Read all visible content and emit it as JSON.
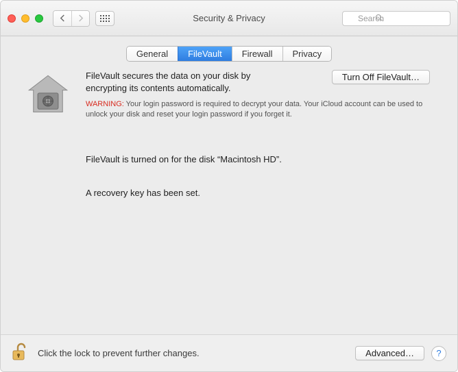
{
  "window": {
    "title": "Security & Privacy"
  },
  "toolbar": {
    "search_placeholder": "Search"
  },
  "tabs": [
    {
      "label": "General"
    },
    {
      "label": "FileVault",
      "active": true
    },
    {
      "label": "Firewall"
    },
    {
      "label": "Privacy"
    }
  ],
  "main": {
    "intro": "FileVault secures the data on your disk by encrypting its contents automatically.",
    "warning_label": "WARNING:",
    "warning_text": " Your login password is required to decrypt your data. Your iCloud account can be used to unlock your disk and reset your login password if you forget it.",
    "turn_off_label": "Turn Off FileVault…",
    "status_on": "FileVault is turned on for the disk “Macintosh HD”.",
    "recovery_set": "A recovery key has been set."
  },
  "footer": {
    "lock_text": "Click the lock to prevent further changes.",
    "advanced_label": "Advanced…",
    "help_label": "?"
  }
}
